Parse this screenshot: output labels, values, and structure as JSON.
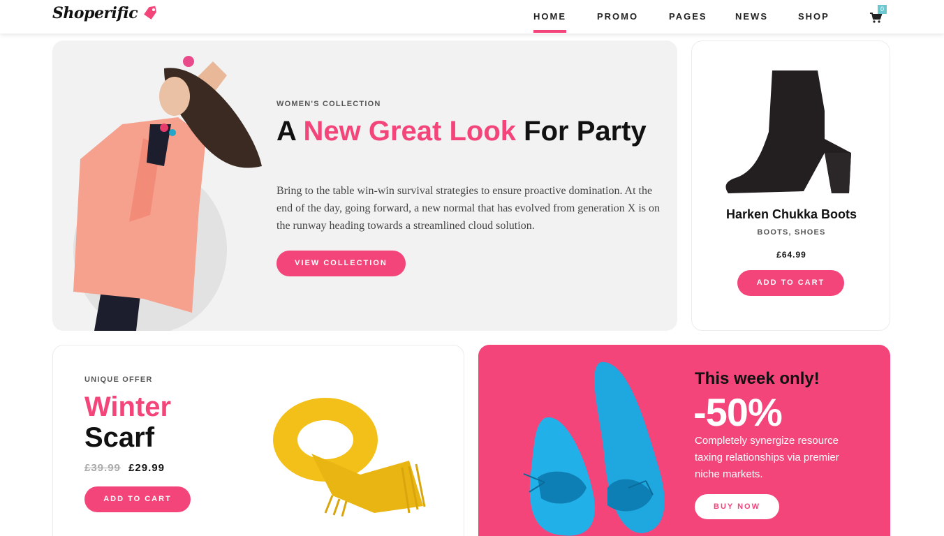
{
  "brand": {
    "name": "Shoperific",
    "accent": "#f4457b",
    "badge_color": "#6cc6cf"
  },
  "nav": {
    "items": [
      {
        "label": "HOME",
        "active": true
      },
      {
        "label": "PROMO",
        "active": false
      },
      {
        "label": "PAGES",
        "active": false
      },
      {
        "label": "NEWS",
        "active": false
      },
      {
        "label": "SHOP",
        "active": false
      }
    ],
    "cart_icon": "shopping-cart-icon",
    "cart_count": "0"
  },
  "hero": {
    "eyebrow": "WOMEN'S COLLECTION",
    "title_prefix": "A ",
    "title_highlight": "New Great Look",
    "title_suffix": " For Party",
    "description": "Bring to the table win-win survival strategies to ensure proactive domination. At the end of the day, going forward, a new normal that has evolved from generation X is on the runway heading towards a streamlined cloud solution.",
    "button": "VIEW COLLECTION"
  },
  "featured_product": {
    "name": "Harken Chukka Boots",
    "categories": "BOOTS, SHOES",
    "price": "£64.99",
    "button": "ADD TO CART"
  },
  "offer": {
    "eyebrow": "UNIQUE OFFER",
    "title_line1": "Winter",
    "title_line2": "Scarf",
    "old_price": "£39.99",
    "new_price": "£29.99",
    "button": "ADD TO CART"
  },
  "promo": {
    "title": "This week only!",
    "discount": "-50%",
    "description": "Completely synergize resource taxing relationships via premier niche markets.",
    "button": "BUY NOW"
  }
}
